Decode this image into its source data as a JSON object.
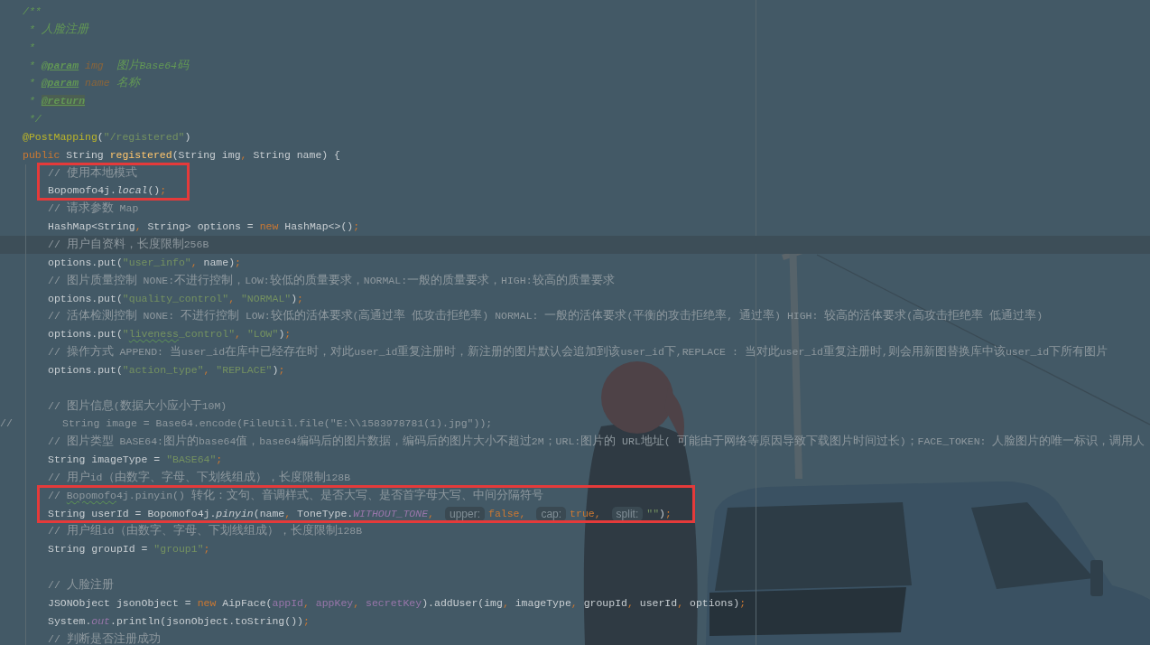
{
  "editor": {
    "doc_comment": [
      {
        "tokens": [
          {
            "text": "/**",
            "kind": "doc"
          }
        ]
      },
      {
        "tokens": [
          {
            "text": " * 人脸注册",
            "kind": "doc"
          }
        ]
      },
      {
        "tokens": [
          {
            "text": " *",
            "kind": "doc"
          }
        ]
      },
      {
        "tokens": [
          {
            "text": " * ",
            "kind": "doc"
          },
          {
            "text": "@param",
            "kind": "doc_tag"
          },
          {
            "text": " img",
            "kind": "doc_param"
          },
          {
            "text": "  图片Base64码",
            "kind": "doc"
          }
        ]
      },
      {
        "tokens": [
          {
            "text": " * ",
            "kind": "doc"
          },
          {
            "text": "@param",
            "kind": "doc_tag"
          },
          {
            "text": " name",
            "kind": "doc_param"
          },
          {
            "text": " 名称",
            "kind": "doc"
          }
        ]
      },
      {
        "tokens": [
          {
            "text": " * ",
            "kind": "doc"
          },
          {
            "text": "@return",
            "kind": "doc_tag_flagged"
          }
        ]
      },
      {
        "tokens": [
          {
            "text": " */",
            "kind": "doc"
          }
        ]
      }
    ],
    "annotation": {
      "tokens": [
        {
          "text": "@PostMapping",
          "kind": "annotation"
        },
        {
          "text": "(",
          "kind": "plain"
        },
        {
          "text": "\"/registered\"",
          "kind": "string"
        },
        {
          "text": ")",
          "kind": "plain"
        }
      ]
    },
    "signature": {
      "tokens": [
        {
          "text": "public",
          "kind": "keyword"
        },
        {
          "text": " String ",
          "kind": "plain"
        },
        {
          "text": "registered",
          "kind": "method"
        },
        {
          "text": "(String img",
          "kind": "plain"
        },
        {
          "text": ", ",
          "kind": "keyword"
        },
        {
          "text": "String name) {",
          "kind": "plain"
        }
      ]
    },
    "body": [
      {
        "kind": "framed",
        "lines": [
          {
            "kind": "line",
            "current": false,
            "tokens": [
              {
                "text": "// 使用本地模式",
                "kind": "comment"
              }
            ]
          },
          {
            "kind": "line",
            "current": false,
            "tokens": [
              {
                "text": "Bopomofo4j.",
                "kind": "plain"
              },
              {
                "text": "local",
                "kind": "italic"
              },
              {
                "text": "()",
                "kind": "plain"
              },
              {
                "text": ";",
                "kind": "keyword"
              }
            ]
          }
        ]
      },
      {
        "kind": "line",
        "current": false,
        "tokens": [
          {
            "text": "// 请求参数 Map",
            "kind": "comment"
          }
        ]
      },
      {
        "kind": "line",
        "current": false,
        "tokens": [
          {
            "text": "HashMap<String",
            "kind": "plain"
          },
          {
            "text": ", ",
            "kind": "keyword"
          },
          {
            "text": "String> options = ",
            "kind": "plain"
          },
          {
            "text": "new",
            "kind": "keyword"
          },
          {
            "text": " HashMap<>()",
            "kind": "plain"
          },
          {
            "text": ";",
            "kind": "keyword"
          }
        ]
      },
      {
        "kind": "line",
        "current": true,
        "tokens": [
          {
            "text": "// 用户自资料，长度限制256B",
            "kind": "comment"
          }
        ]
      },
      {
        "kind": "line",
        "current": false,
        "tokens": [
          {
            "text": "options.put(",
            "kind": "plain"
          },
          {
            "text": "\"user_info\"",
            "kind": "string"
          },
          {
            "text": ", ",
            "kind": "keyword"
          },
          {
            "text": "name)",
            "kind": "plain"
          },
          {
            "text": ";",
            "kind": "keyword"
          }
        ]
      },
      {
        "kind": "line",
        "current": false,
        "tokens": [
          {
            "text": "// 图片质量控制 NONE:不进行控制，LOW:较低的质量要求，NORMAL:一般的质量要求，HIGH:较高的质量要求",
            "kind": "comment"
          }
        ]
      },
      {
        "kind": "line",
        "current": false,
        "tokens": [
          {
            "text": "options.put(",
            "kind": "plain"
          },
          {
            "text": "\"quality_control\"",
            "kind": "string"
          },
          {
            "text": ", ",
            "kind": "keyword"
          },
          {
            "text": "\"NORMAL\"",
            "kind": "string"
          },
          {
            "text": ")",
            "kind": "plain"
          },
          {
            "text": ";",
            "kind": "keyword"
          }
        ]
      },
      {
        "kind": "line",
        "current": false,
        "tokens": [
          {
            "text": "// 活体检测控制 NONE: 不进行控制 LOW:较低的活体要求(高通过率 低攻击拒绝率) NORMAL: 一般的活体要求(平衡的攻击拒绝率, 通过率) HIGH: 较高的活体要求(高攻击拒绝率 低通过率)",
            "kind": "comment"
          }
        ]
      },
      {
        "kind": "line",
        "current": false,
        "tokens": [
          {
            "text": "options.put(",
            "kind": "plain"
          },
          {
            "text": "\"",
            "kind": "string"
          },
          {
            "text": "liveness",
            "kind": "string_typo"
          },
          {
            "text": "_control\"",
            "kind": "string"
          },
          {
            "text": ", ",
            "kind": "keyword"
          },
          {
            "text": "\"LOW\"",
            "kind": "string"
          },
          {
            "text": ")",
            "kind": "plain"
          },
          {
            "text": ";",
            "kind": "keyword"
          }
        ]
      },
      {
        "kind": "line",
        "current": false,
        "tokens": [
          {
            "text": "// 操作方式 APPEND: 当user_id在库中已经存在时，对此user_id重复注册时，新注册的图片默认会追加到该user_id下,REPLACE : 当对此user_id重复注册时,则会用新图替换库中该user_id下所有图片",
            "kind": "comment"
          }
        ]
      },
      {
        "kind": "line",
        "current": false,
        "tokens": [
          {
            "text": "options.put(",
            "kind": "plain"
          },
          {
            "text": "\"action_type\"",
            "kind": "string"
          },
          {
            "text": ", ",
            "kind": "keyword"
          },
          {
            "text": "\"REPLACE\"",
            "kind": "string"
          },
          {
            "text": ")",
            "kind": "plain"
          },
          {
            "text": ";",
            "kind": "keyword"
          }
        ]
      },
      {
        "kind": "blank",
        "current": false
      },
      {
        "kind": "line",
        "current": false,
        "tokens": [
          {
            "text": "// 图片信息(数据大小应小于10M)",
            "kind": "comment"
          }
        ]
      },
      {
        "kind": "commented_out",
        "current": false,
        "text": "//        String image = Base64.encode(FileUtil.file(\"E:\\\\1583978781(1).jpg\"));"
      },
      {
        "kind": "line",
        "current": false,
        "tokens": [
          {
            "text": "// 图片类型 BASE64:图片的base64值，base64编码后的图片数据，编码后的图片大小不超过2M；URL:图片的 URL地址( 可能由于网络等原因导致下载图片时间过长)；FACE_TOKEN: 人脸图片的唯一标识，调用人",
            "kind": "comment"
          }
        ]
      },
      {
        "kind": "line",
        "current": false,
        "tokens": [
          {
            "text": "String imageType = ",
            "kind": "plain"
          },
          {
            "text": "\"BASE64\"",
            "kind": "string"
          },
          {
            "text": ";",
            "kind": "keyword"
          }
        ]
      },
      {
        "kind": "line",
        "current": false,
        "tokens": [
          {
            "text": "// 用户id（由数字、字母、下划线组成），长度限制128B",
            "kind": "comment"
          }
        ]
      },
      {
        "kind": "framed",
        "lines": [
          {
            "kind": "line",
            "current": false,
            "tokens": [
              {
                "text": "// ",
                "kind": "comment"
              },
              {
                "text": "Bopomofo",
                "kind": "comment_typo"
              },
              {
                "text": "4j.pinyin() 转化：文句、音调样式、是否大写、是否首字母大写、中间分隔符号",
                "kind": "comment"
              }
            ]
          },
          {
            "kind": "line",
            "current": false,
            "tokens": [
              {
                "text": "String userId = Bopomofo4j.",
                "kind": "plain"
              },
              {
                "text": "pinyin",
                "kind": "italic"
              },
              {
                "text": "(name",
                "kind": "plain"
              },
              {
                "text": ", ",
                "kind": "keyword"
              },
              {
                "text": "ToneType.",
                "kind": "plain"
              },
              {
                "text": "WITHOUT_TONE",
                "kind": "static_field"
              },
              {
                "text": ",",
                "kind": "keyword"
              },
              {
                "text": "upper:",
                "kind": "hint"
              },
              {
                "text": "false,",
                "kind": "keyword"
              },
              {
                "text": "cap:",
                "kind": "hint"
              },
              {
                "text": "true,",
                "kind": "keyword"
              },
              {
                "text": "split:",
                "kind": "hint"
              },
              {
                "text": "\"\"",
                "kind": "string"
              },
              {
                "text": ")",
                "kind": "plain"
              },
              {
                "text": ";",
                "kind": "keyword"
              }
            ]
          }
        ]
      },
      {
        "kind": "line",
        "current": false,
        "tokens": [
          {
            "text": "// 用户组id（由数字、字母、下划线组成），长度限制128B",
            "kind": "comment"
          }
        ]
      },
      {
        "kind": "line",
        "current": false,
        "tokens": [
          {
            "text": "String groupId = ",
            "kind": "plain"
          },
          {
            "text": "\"group1\"",
            "kind": "string"
          },
          {
            "text": ";",
            "kind": "keyword"
          }
        ]
      },
      {
        "kind": "blank",
        "current": false
      },
      {
        "kind": "line",
        "current": false,
        "tokens": [
          {
            "text": "// 人脸注册",
            "kind": "comment"
          }
        ]
      },
      {
        "kind": "line",
        "current": false,
        "tokens": [
          {
            "text": "JSONObject jsonObject = ",
            "kind": "plain"
          },
          {
            "text": "new",
            "kind": "keyword"
          },
          {
            "text": " AipFace(",
            "kind": "plain"
          },
          {
            "text": "appId",
            "kind": "field"
          },
          {
            "text": ", ",
            "kind": "keyword"
          },
          {
            "text": "appKey",
            "kind": "field"
          },
          {
            "text": ", ",
            "kind": "keyword"
          },
          {
            "text": "secretKey",
            "kind": "field"
          },
          {
            "text": ").addUser(img",
            "kind": "plain"
          },
          {
            "text": ", ",
            "kind": "keyword"
          },
          {
            "text": "imageType",
            "kind": "plain"
          },
          {
            "text": ", ",
            "kind": "keyword"
          },
          {
            "text": "groupId",
            "kind": "plain"
          },
          {
            "text": ", ",
            "kind": "keyword"
          },
          {
            "text": "userId",
            "kind": "plain"
          },
          {
            "text": ", ",
            "kind": "keyword"
          },
          {
            "text": "options)",
            "kind": "plain"
          },
          {
            "text": ";",
            "kind": "keyword"
          }
        ]
      },
      {
        "kind": "line",
        "current": false,
        "tokens": [
          {
            "text": "System.",
            "kind": "plain"
          },
          {
            "text": "out",
            "kind": "static_field"
          },
          {
            "text": ".println(jsonObject.toString())",
            "kind": "plain"
          },
          {
            "text": ";",
            "kind": "keyword"
          }
        ]
      },
      {
        "kind": "line",
        "current": false,
        "tokens": [
          {
            "text": "// 判断是否注册成功",
            "kind": "comment"
          }
        ]
      }
    ]
  }
}
